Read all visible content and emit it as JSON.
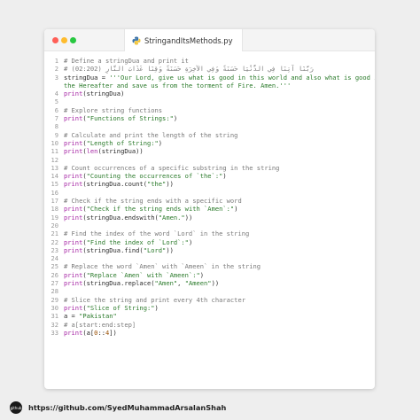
{
  "tab": {
    "filename": "StringandItsMethods.py",
    "icon": "python-file-icon"
  },
  "window_controls": [
    "close",
    "minimize",
    "maximize"
  ],
  "code_lines": [
    {
      "n": "1",
      "tokens": [
        {
          "t": "# Define a stringDua and print it",
          "c": "c"
        }
      ]
    },
    {
      "n": "2",
      "tokens": [
        {
          "t": "# رَبَّنَا آتِنَا فِي الدُّنْيَا حَسَنَةً وَفِي الآخِرَةِ حَسَنَةً وَقِنَا عَذَابَ النَّارِ (02:202)",
          "c": "c"
        }
      ]
    },
    {
      "n": "3",
      "tokens": [
        {
          "t": "stringDua = ",
          "c": ""
        },
        {
          "t": "'''Our Lord, give us what is good in this world and also what is good in",
          "c": "s"
        }
      ]
    },
    {
      "n": "",
      "tokens": [
        {
          "t": "the Hereafter and save us from the torment of Fire. Amen.'''",
          "c": "s"
        }
      ]
    },
    {
      "n": "4",
      "tokens": [
        {
          "t": "print",
          "c": "k"
        },
        {
          "t": "(stringDua)",
          "c": ""
        }
      ]
    },
    {
      "n": "5",
      "tokens": []
    },
    {
      "n": "6",
      "tokens": [
        {
          "t": "# Explore string functions",
          "c": "c"
        }
      ]
    },
    {
      "n": "7",
      "tokens": [
        {
          "t": "print",
          "c": "k"
        },
        {
          "t": "(",
          "c": ""
        },
        {
          "t": "\"Functions of Strings:\"",
          "c": "s"
        },
        {
          "t": ")",
          "c": ""
        }
      ]
    },
    {
      "n": "8",
      "tokens": []
    },
    {
      "n": "9",
      "tokens": [
        {
          "t": "# Calculate and print the length of the string",
          "c": "c"
        }
      ]
    },
    {
      "n": "10",
      "tokens": [
        {
          "t": "print",
          "c": "k"
        },
        {
          "t": "(",
          "c": ""
        },
        {
          "t": "\"Length of String:\"",
          "c": "s"
        },
        {
          "t": ")",
          "c": ""
        }
      ]
    },
    {
      "n": "11",
      "tokens": [
        {
          "t": "print",
          "c": "k"
        },
        {
          "t": "(",
          "c": ""
        },
        {
          "t": "len",
          "c": "k"
        },
        {
          "t": "(stringDua))",
          "c": ""
        }
      ]
    },
    {
      "n": "12",
      "tokens": []
    },
    {
      "n": "13",
      "tokens": [
        {
          "t": "# Count occurrences of a specific substring in the string",
          "c": "c"
        }
      ]
    },
    {
      "n": "14",
      "tokens": [
        {
          "t": "print",
          "c": "k"
        },
        {
          "t": "(",
          "c": ""
        },
        {
          "t": "\"Counting the occurrences of `the`:\"",
          "c": "s"
        },
        {
          "t": ")",
          "c": ""
        }
      ]
    },
    {
      "n": "15",
      "tokens": [
        {
          "t": "print",
          "c": "k"
        },
        {
          "t": "(stringDua.count(",
          "c": ""
        },
        {
          "t": "\"the\"",
          "c": "s"
        },
        {
          "t": "))",
          "c": ""
        }
      ]
    },
    {
      "n": "16",
      "tokens": []
    },
    {
      "n": "17",
      "tokens": [
        {
          "t": "# Check if the string ends with a specific word",
          "c": "c"
        }
      ]
    },
    {
      "n": "18",
      "tokens": [
        {
          "t": "print",
          "c": "k"
        },
        {
          "t": "(",
          "c": ""
        },
        {
          "t": "\"Check if the string ends with `Amen`:\"",
          "c": "s"
        },
        {
          "t": ")",
          "c": ""
        }
      ]
    },
    {
      "n": "19",
      "tokens": [
        {
          "t": "print",
          "c": "k"
        },
        {
          "t": "(stringDua.endswith(",
          "c": ""
        },
        {
          "t": "\"Amen.\"",
          "c": "s"
        },
        {
          "t": "))",
          "c": ""
        }
      ]
    },
    {
      "n": "20",
      "tokens": []
    },
    {
      "n": "21",
      "tokens": [
        {
          "t": "# Find the index of the word `Lord` in the string",
          "c": "c"
        }
      ]
    },
    {
      "n": "22",
      "tokens": [
        {
          "t": "print",
          "c": "k"
        },
        {
          "t": "(",
          "c": ""
        },
        {
          "t": "\"Find the index of `Lord`:\"",
          "c": "s"
        },
        {
          "t": ")",
          "c": ""
        }
      ]
    },
    {
      "n": "23",
      "tokens": [
        {
          "t": "print",
          "c": "k"
        },
        {
          "t": "(stringDua.find(",
          "c": ""
        },
        {
          "t": "\"Lord\"",
          "c": "s"
        },
        {
          "t": "))",
          "c": ""
        }
      ]
    },
    {
      "n": "24",
      "tokens": []
    },
    {
      "n": "25",
      "tokens": [
        {
          "t": "# Replace the word `Amen` with `Ameen` in the string",
          "c": "c"
        }
      ]
    },
    {
      "n": "26",
      "tokens": [
        {
          "t": "print",
          "c": "k"
        },
        {
          "t": "(",
          "c": ""
        },
        {
          "t": "\"Replace `Amen` with `Ameen`:\"",
          "c": "s"
        },
        {
          "t": ")",
          "c": ""
        }
      ]
    },
    {
      "n": "27",
      "tokens": [
        {
          "t": "print",
          "c": "k"
        },
        {
          "t": "(stringDua.replace(",
          "c": ""
        },
        {
          "t": "\"Amen\"",
          "c": "s"
        },
        {
          "t": ", ",
          "c": ""
        },
        {
          "t": "\"Ameen\"",
          "c": "s"
        },
        {
          "t": "))",
          "c": ""
        }
      ]
    },
    {
      "n": "28",
      "tokens": []
    },
    {
      "n": "29",
      "tokens": [
        {
          "t": "# Slice the string and print every 4th character",
          "c": "c"
        }
      ]
    },
    {
      "n": "30",
      "tokens": [
        {
          "t": "print",
          "c": "k"
        },
        {
          "t": "(",
          "c": ""
        },
        {
          "t": "\"Slice of String:\"",
          "c": "s"
        },
        {
          "t": ")",
          "c": ""
        }
      ]
    },
    {
      "n": "31",
      "tokens": [
        {
          "t": "a = ",
          "c": ""
        },
        {
          "t": "\"Pakistan\"",
          "c": "s"
        }
      ]
    },
    {
      "n": "32",
      "tokens": [
        {
          "t": "# a[start:end:step]",
          "c": "c"
        }
      ]
    },
    {
      "n": "33",
      "tokens": [
        {
          "t": "print",
          "c": "k"
        },
        {
          "t": "(a[",
          "c": ""
        },
        {
          "t": "0",
          "c": "n"
        },
        {
          "t": "::",
          "c": ""
        },
        {
          "t": "4",
          "c": "n"
        },
        {
          "t": "])",
          "c": ""
        }
      ]
    }
  ],
  "footer": {
    "logo_text": "github",
    "url": "https://github.com/SyedMuhammadArsalanShah"
  }
}
